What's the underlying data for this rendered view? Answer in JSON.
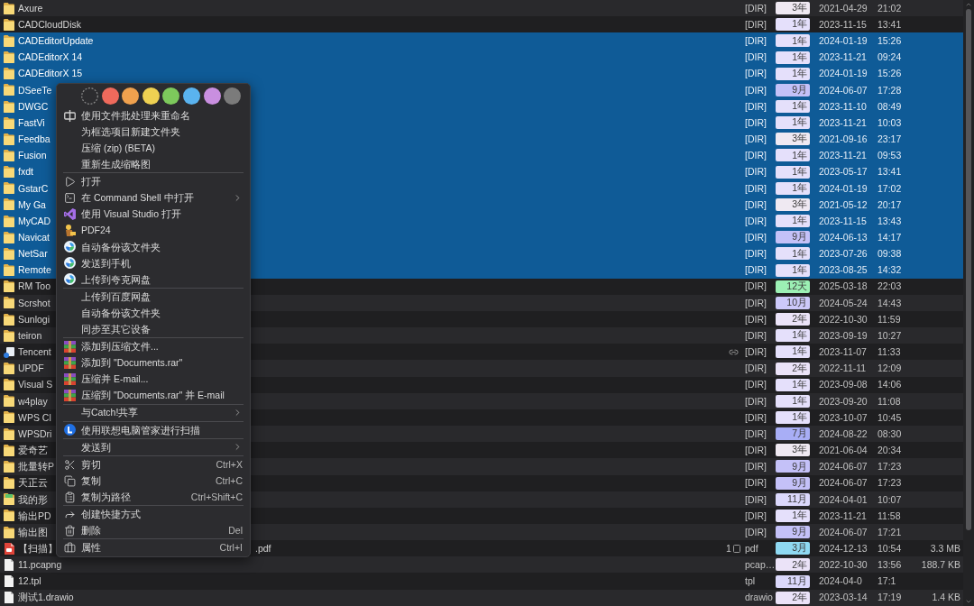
{
  "file_list": {
    "rows": [
      {
        "kind": "folder",
        "name": "Axure",
        "selected": false,
        "linked": false,
        "type": "[DIR]",
        "age": {
          "label": "3年",
          "color": "#efe9f2"
        },
        "date": "2021-04-29",
        "time": "21:02"
      },
      {
        "kind": "folder",
        "name": "CADCloudDisk",
        "selected": false,
        "linked": false,
        "type": "[DIR]",
        "age": {
          "label": "1年",
          "color": "#e5e0fb"
        },
        "date": "2023-11-15",
        "time": "13:41"
      },
      {
        "kind": "folder",
        "name": "CADEditorUpdate",
        "selected": true,
        "linked": false,
        "type": "[DIR]",
        "age": {
          "label": "1年",
          "color": "#e5e0fb"
        },
        "date": "2024-01-19",
        "time": "15:26"
      },
      {
        "kind": "folder",
        "name": "CADEditorX 14",
        "selected": true,
        "linked": false,
        "type": "[DIR]",
        "age": {
          "label": "1年",
          "color": "#e5e0fb"
        },
        "date": "2023-11-21",
        "time": "09:24"
      },
      {
        "kind": "folder",
        "name": "CADEditorX 15",
        "selected": true,
        "linked": false,
        "type": "[DIR]",
        "age": {
          "label": "1年",
          "color": "#e5e0fb"
        },
        "date": "2024-01-19",
        "time": "15:26"
      },
      {
        "kind": "folder",
        "name": "DSeeTe",
        "selected": true,
        "linked": false,
        "type": "[DIR]",
        "age": {
          "label": "9月",
          "color": "#c4c1f8"
        },
        "date": "2024-06-07",
        "time": "17:28"
      },
      {
        "kind": "folder",
        "name": "DWGC",
        "selected": true,
        "linked": false,
        "type": "[DIR]",
        "age": {
          "label": "1年",
          "color": "#e5e0fb"
        },
        "date": "2023-11-10",
        "time": "08:49"
      },
      {
        "kind": "folder",
        "name": "FastVi",
        "selected": true,
        "linked": false,
        "type": "[DIR]",
        "age": {
          "label": "1年",
          "color": "#e5e0fb"
        },
        "date": "2023-11-21",
        "time": "10:03"
      },
      {
        "kind": "folder",
        "name": "Feedba",
        "selected": true,
        "linked": false,
        "type": "[DIR]",
        "age": {
          "label": "3年",
          "color": "#efe9f2"
        },
        "date": "2021-09-16",
        "time": "23:17"
      },
      {
        "kind": "folder",
        "name": "Fusion",
        "selected": true,
        "linked": false,
        "type": "[DIR]",
        "age": {
          "label": "1年",
          "color": "#e5e0fb"
        },
        "date": "2023-11-21",
        "time": "09:53"
      },
      {
        "kind": "folder",
        "name": "fxdt",
        "selected": true,
        "linked": false,
        "type": "[DIR]",
        "age": {
          "label": "1年",
          "color": "#e5e0fb"
        },
        "date": "2023-05-17",
        "time": "13:41"
      },
      {
        "kind": "folder",
        "name": "GstarC",
        "selected": true,
        "linked": false,
        "type": "[DIR]",
        "age": {
          "label": "1年",
          "color": "#e5e0fb"
        },
        "date": "2024-01-19",
        "time": "17:02"
      },
      {
        "kind": "folder",
        "name": "My Ga",
        "selected": true,
        "linked": false,
        "type": "[DIR]",
        "age": {
          "label": "3年",
          "color": "#efe9f2"
        },
        "date": "2021-05-12",
        "time": "20:17"
      },
      {
        "kind": "folder",
        "name": "MyCAD",
        "selected": true,
        "linked": false,
        "type": "[DIR]",
        "age": {
          "label": "1年",
          "color": "#e5e0fb"
        },
        "date": "2023-11-15",
        "time": "13:43"
      },
      {
        "kind": "folder",
        "name": "Navicat",
        "selected": true,
        "linked": false,
        "type": "[DIR]",
        "age": {
          "label": "9月",
          "color": "#c4c1f8"
        },
        "date": "2024-06-13",
        "time": "14:17"
      },
      {
        "kind": "folder",
        "name": "NetSar",
        "selected": true,
        "linked": false,
        "type": "[DIR]",
        "age": {
          "label": "1年",
          "color": "#e5e0fb"
        },
        "date": "2023-07-26",
        "time": "09:38"
      },
      {
        "kind": "folder",
        "name": "Remote",
        "selected": true,
        "linked": false,
        "type": "[DIR]",
        "age": {
          "label": "1年",
          "color": "#e5e0fb"
        },
        "date": "2023-08-25",
        "time": "14:32"
      },
      {
        "kind": "folder",
        "name": "RM Too",
        "selected": false,
        "linked": false,
        "type": "[DIR]",
        "age": {
          "label": "12天",
          "color": "#9cf0b4"
        },
        "date": "2025-03-18",
        "time": "22:03"
      },
      {
        "kind": "folder",
        "name": "Scrshot",
        "selected": false,
        "linked": false,
        "type": "[DIR]",
        "age": {
          "label": "10月",
          "color": "#cdc9fa"
        },
        "date": "2024-05-24",
        "time": "14:43"
      },
      {
        "kind": "folder",
        "name": "Sunlogi",
        "selected": false,
        "linked": false,
        "type": "[DIR]",
        "age": {
          "label": "2年",
          "color": "#ebe3f8"
        },
        "date": "2022-10-30",
        "time": "11:59"
      },
      {
        "kind": "folder",
        "name": "teiron",
        "selected": false,
        "linked": false,
        "type": "[DIR]",
        "age": {
          "label": "1年",
          "color": "#e5e0fb"
        },
        "date": "2023-09-19",
        "time": "10:27"
      },
      {
        "kind": "shortcut",
        "name": "Tencent",
        "selected": false,
        "linked": true,
        "type": "[DIR]",
        "age": {
          "label": "1年",
          "color": "#e5e0fb"
        },
        "date": "2023-11-07",
        "time": "11:33"
      },
      {
        "kind": "folder",
        "name": "UPDF",
        "selected": false,
        "linked": false,
        "type": "[DIR]",
        "age": {
          "label": "2年",
          "color": "#ebe3f8"
        },
        "date": "2022-11-11",
        "time": "12:09"
      },
      {
        "kind": "folder",
        "name": "Visual S",
        "selected": false,
        "linked": false,
        "type": "[DIR]",
        "age": {
          "label": "1年",
          "color": "#e5e0fb"
        },
        "date": "2023-09-08",
        "time": "14:06"
      },
      {
        "kind": "folder",
        "name": "w4play",
        "selected": false,
        "linked": false,
        "type": "[DIR]",
        "age": {
          "label": "1年",
          "color": "#e5e0fb"
        },
        "date": "2023-09-20",
        "time": "11:08"
      },
      {
        "kind": "folder",
        "name": "WPS Cl",
        "selected": false,
        "linked": false,
        "type": "[DIR]",
        "age": {
          "label": "1年",
          "color": "#e5e0fb"
        },
        "date": "2023-10-07",
        "time": "10:45"
      },
      {
        "kind": "folder",
        "name": "WPSDri",
        "selected": false,
        "linked": false,
        "type": "[DIR]",
        "age": {
          "label": "7月",
          "color": "#a8aef6"
        },
        "date": "2024-08-22",
        "time": "08:30"
      },
      {
        "kind": "folder",
        "name": "爱奇艺",
        "selected": false,
        "linked": false,
        "type": "[DIR]",
        "age": {
          "label": "3年",
          "color": "#efe9f2"
        },
        "date": "2021-06-04",
        "time": "20:34"
      },
      {
        "kind": "folder",
        "name": "批量转P",
        "selected": false,
        "linked": false,
        "type": "[DIR]",
        "age": {
          "label": "9月",
          "color": "#c4c1f8"
        },
        "date": "2024-06-07",
        "time": "17:23"
      },
      {
        "kind": "folder",
        "name": "天正云",
        "selected": false,
        "linked": false,
        "type": "[DIR]",
        "age": {
          "label": "9月",
          "color": "#c4c1f8"
        },
        "date": "2024-06-07",
        "time": "17:23"
      },
      {
        "kind": "special",
        "name": "我的形",
        "selected": false,
        "linked": false,
        "type": "[DIR]",
        "age": {
          "label": "11月",
          "color": "#dbd8fb"
        },
        "date": "2024-04-01",
        "time": "10:07"
      },
      {
        "kind": "folder",
        "name": "输出PD",
        "selected": false,
        "linked": false,
        "type": "[DIR]",
        "age": {
          "label": "1年",
          "color": "#e5e0fb"
        },
        "date": "2023-11-21",
        "time": "11:58"
      },
      {
        "kind": "folder",
        "name": "输出图",
        "selected": false,
        "linked": false,
        "type": "[DIR]",
        "age": {
          "label": "9月",
          "color": "#c4c1f8"
        },
        "date": "2024-06-07",
        "time": "17:21"
      },
      {
        "kind": "pdf",
        "name": "【扫描】",
        "name_tail": ".pdf",
        "selected": false,
        "linked": false,
        "count": "1",
        "type": "pdf",
        "age": {
          "label": "3月",
          "color": "#8fd9f2"
        },
        "date": "2024-12-13",
        "time": "10:54",
        "size": "3.3 MB"
      },
      {
        "kind": "file",
        "name": "11.pcapng",
        "selected": false,
        "linked": false,
        "type": "pcap…",
        "age": {
          "label": "2年",
          "color": "#ebe3f8"
        },
        "date": "2022-10-30",
        "time": "13:56",
        "size": "188.7 KB"
      },
      {
        "kind": "file",
        "name": "12.tpl",
        "selected": false,
        "linked": false,
        "type": "tpl",
        "age": {
          "label": "11月",
          "color": "#dbd8fb"
        },
        "date": "2024-04-0",
        "time": "17:1"
      },
      {
        "kind": "file",
        "name": "测试1.drawio",
        "selected": false,
        "linked": false,
        "type": "drawio",
        "age": {
          "label": "2年",
          "color": "#ebe3f8"
        },
        "date": "2023-03-14",
        "time": "17:19",
        "size": "1.4 KB"
      }
    ]
  },
  "context_menu": {
    "color_tags": [
      {
        "kind": "clear"
      },
      {
        "kind": "swatch",
        "color": "#ef6a5c"
      },
      {
        "kind": "swatch",
        "color": "#f0a14e"
      },
      {
        "kind": "swatch",
        "color": "#efd152"
      },
      {
        "kind": "swatch",
        "color": "#7dc95c"
      },
      {
        "kind": "swatch",
        "color": "#5ab3ef"
      },
      {
        "kind": "swatch",
        "color": "#c98fe0"
      },
      {
        "kind": "swatch",
        "color": "#7b7b7b"
      }
    ],
    "groups": [
      {
        "items": [
          {
            "kind": "rename",
            "label": "使用文件批处理来重命名",
            "submenu": false
          },
          {
            "kind": "plain",
            "label": "为框选项目新建文件夹",
            "submenu": false
          },
          {
            "kind": "plain",
            "label": "压缩 (zip) (BETA)",
            "submenu": false
          },
          {
            "kind": "plain",
            "label": "重新生成缩略图",
            "submenu": false
          }
        ]
      },
      {
        "items": [
          {
            "kind": "open",
            "label": "打开",
            "submenu": false
          },
          {
            "kind": "terminal",
            "label": "在 Command Shell 中打开",
            "submenu": true
          },
          {
            "kind": "vs",
            "label": "使用 Visual Studio 打开",
            "submenu": false
          },
          {
            "kind": "pdf24",
            "label": "PDF24",
            "submenu": false
          },
          {
            "kind": "cloud",
            "label": "自动备份该文件夹",
            "submenu": false
          },
          {
            "kind": "cloud",
            "label": "发送到手机",
            "submenu": false
          },
          {
            "kind": "cloud",
            "label": "上传到夸克网盘",
            "submenu": false
          }
        ]
      },
      {
        "items": [
          {
            "kind": "plain",
            "label": "上传到百度网盘",
            "submenu": false
          },
          {
            "kind": "plain",
            "label": "自动备份该文件夹",
            "submenu": false
          },
          {
            "kind": "plain",
            "label": "同步至其它设备",
            "submenu": false
          }
        ]
      },
      {
        "items": [
          {
            "kind": "rar",
            "label": "添加到压缩文件...",
            "submenu": false
          },
          {
            "kind": "rar",
            "label": "添加到 \"Documents.rar\"",
            "submenu": false
          },
          {
            "kind": "rar",
            "label": "压缩并 E-mail...",
            "submenu": false
          },
          {
            "kind": "rar",
            "label": "压缩到 \"Documents.rar\" 并 E-mail",
            "submenu": false
          }
        ]
      },
      {
        "items": [
          {
            "kind": "plain",
            "label": "与Catch!共享",
            "submenu": true
          }
        ]
      },
      {
        "items": [
          {
            "kind": "lenovo",
            "label": "使用联想电脑管家进行扫描",
            "submenu": false
          }
        ]
      },
      {
        "items": [
          {
            "kind": "plain",
            "label": "发送到",
            "submenu": true
          }
        ]
      },
      {
        "items": [
          {
            "kind": "cut",
            "label": "剪切",
            "shortcut": "Ctrl+X",
            "submenu": false
          },
          {
            "kind": "copy",
            "label": "复制",
            "shortcut": "Ctrl+C",
            "submenu": false
          },
          {
            "kind": "copypath",
            "label": "复制为路径",
            "shortcut": "Ctrl+Shift+C",
            "submenu": false
          }
        ]
      },
      {
        "items": [
          {
            "kind": "shortcut",
            "label": "创建快捷方式",
            "submenu": false
          },
          {
            "kind": "delete",
            "label": "删除",
            "shortcut": "Del",
            "submenu": false
          }
        ]
      },
      {
        "items": [
          {
            "kind": "properties",
            "label": "属性",
            "shortcut": "Ctrl+I",
            "submenu": false
          }
        ]
      }
    ]
  }
}
